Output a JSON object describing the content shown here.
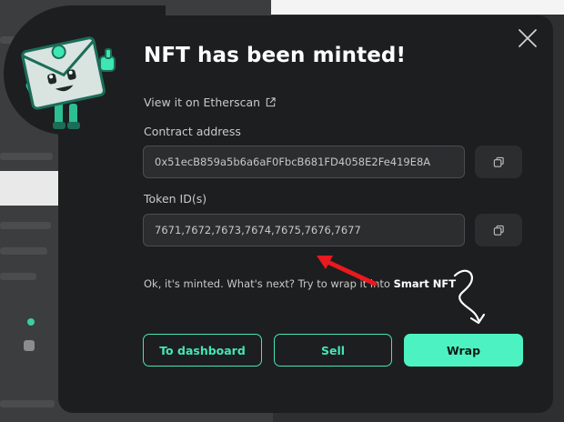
{
  "modal": {
    "title": "NFT has been minted!",
    "etherscan_link": "View it on Etherscan",
    "contract_label": "Contract address",
    "contract_value": "0x51ecB859a5b6a6aF0FbcB681FD4058E2Fe419E8A",
    "token_label": "Token ID(s)",
    "token_value": "7671,7672,7673,7674,7675,7676,7677",
    "hint_text": "Ok, it's minted. What's next? Try to wrap it into ",
    "hint_bold": "Smart NFT",
    "buttons": {
      "dashboard": "To dashboard",
      "sell": "Sell",
      "wrap": "Wrap"
    }
  },
  "icons": {
    "close": "close-icon",
    "external_link": "external-link-icon",
    "copy": "copy-icon",
    "mascot": "envelope-mascot-icon",
    "arrow_red": "red-arrow-icon",
    "arrow_curly": "curly-arrow-icon"
  },
  "colors": {
    "modal_bg": "#1d1e1f",
    "accent": "#4df2c2",
    "field_bg": "#2c2d2f",
    "annotation_red": "#e8191f"
  }
}
